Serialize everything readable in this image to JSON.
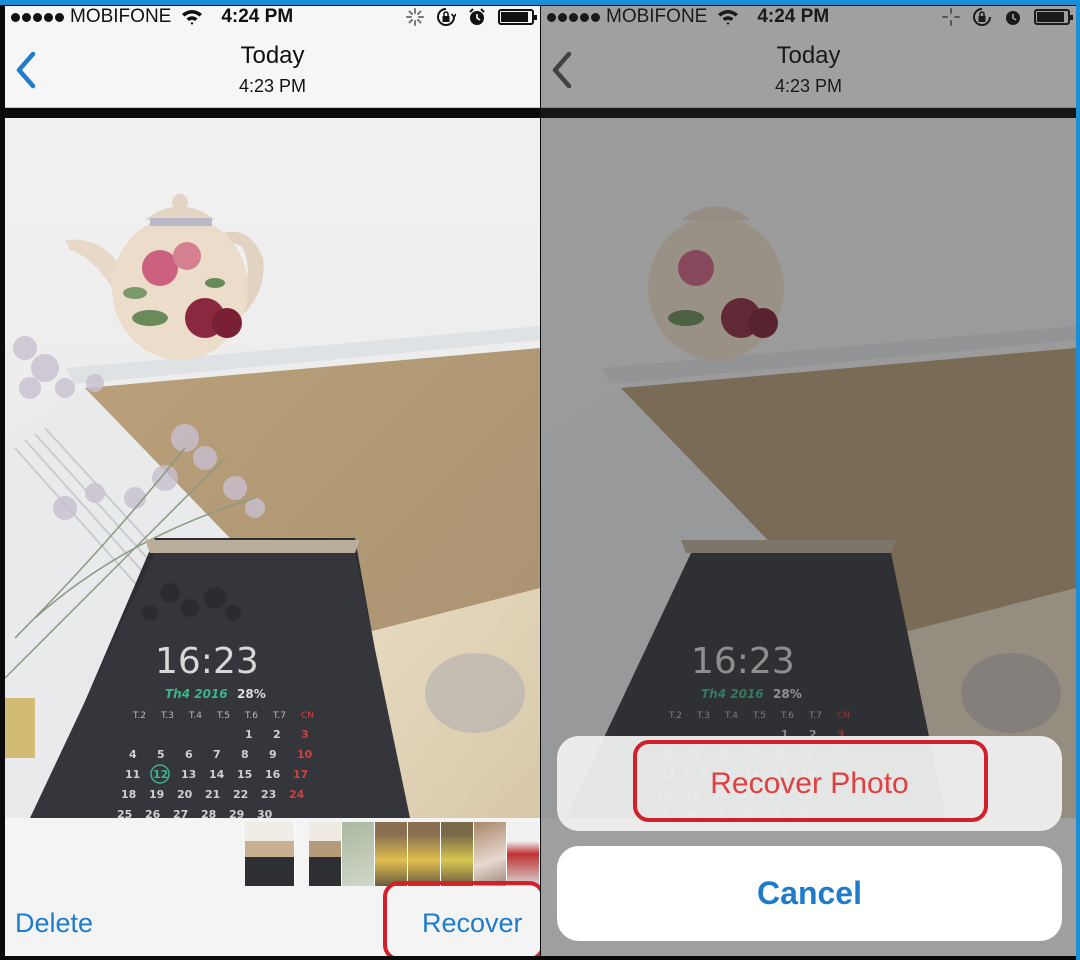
{
  "status_bar": {
    "carrier": "MOBIFONE",
    "time": "4:24 PM",
    "signal_bars": 5,
    "battery_level": 0.9,
    "icons": [
      "signal-dots-icon",
      "wifi-icon",
      "activity-spinner-icon",
      "orientation-lock-icon",
      "alarm-icon",
      "battery-icon"
    ]
  },
  "nav": {
    "title": "Today",
    "subtitle": "4:23 PM",
    "back_icon": "chevron-left-icon"
  },
  "photo_content": {
    "phone_clock": "16:23",
    "phone_date": "Th4 2016",
    "phone_battery": "28%",
    "weekday_headers": [
      "T.2",
      "T.3",
      "T.4",
      "T.5",
      "T.6",
      "T.7",
      "CN"
    ],
    "calendar_rows": [
      [
        "",
        "",
        "",
        "",
        "1",
        "2",
        "3"
      ],
      [
        "4",
        "5",
        "6",
        "7",
        "8",
        "9",
        "10"
      ],
      [
        "11",
        "12",
        "13",
        "14",
        "15",
        "16",
        "17"
      ],
      [
        "18",
        "19",
        "20",
        "21",
        "22",
        "23",
        "24"
      ],
      [
        "25",
        "26",
        "27",
        "28",
        "29",
        "30",
        ""
      ]
    ],
    "highlighted_day": "12"
  },
  "toolbar": {
    "delete_label": "Delete",
    "recover_label": "Recover",
    "thumbnail_count": 8
  },
  "action_sheet": {
    "recover_photo_label": "Recover Photo",
    "cancel_label": "Cancel"
  },
  "colors": {
    "ios_blue": "#1e7ccb",
    "destructive_red": "#e04040",
    "annotation_red": "#d0202a",
    "frame_blue": "#1a8fd8"
  }
}
